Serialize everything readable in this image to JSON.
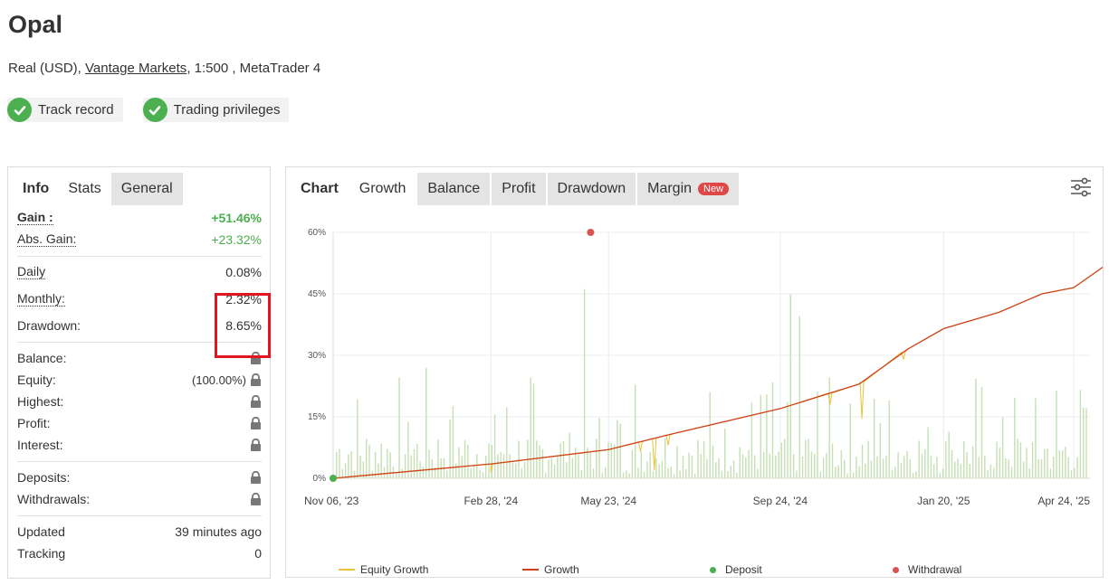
{
  "header": {
    "title": "Opal",
    "account_type": "Real (USD),",
    "broker": "Vantage Markets",
    "leverage_platform": ", 1:500 , MetaTrader 4"
  },
  "badges": [
    {
      "label": "Track record",
      "icon": "check-circle-icon"
    },
    {
      "label": "Trading privileges",
      "icon": "check-circle-icon"
    }
  ],
  "left_tabs": {
    "label": "Info",
    "items": [
      {
        "label": "Stats",
        "active": true
      },
      {
        "label": "General",
        "active": false
      }
    ]
  },
  "stats": {
    "gain": {
      "label": "Gain :",
      "value": "+51.46%"
    },
    "abs_gain": {
      "label": "Abs. Gain:",
      "value": "+23.32%"
    },
    "daily": {
      "label": "Daily",
      "value": "0.08%"
    },
    "monthly": {
      "label": "Monthly:",
      "value": "2.32%"
    },
    "drawdown": {
      "label": "Drawdown:",
      "value": "8.65%"
    },
    "balance": {
      "label": "Balance:"
    },
    "equity": {
      "label": "Equity:",
      "value": "(100.00%)"
    },
    "highest": {
      "label": "Highest:"
    },
    "profit": {
      "label": "Profit:"
    },
    "interest": {
      "label": "Interest:"
    },
    "deposits": {
      "label": "Deposits:"
    },
    "withdrawals": {
      "label": "Withdrawals:"
    },
    "updated": {
      "label": "Updated",
      "value": "39 minutes ago"
    },
    "tracking": {
      "label": "Tracking",
      "value": "0"
    }
  },
  "right_tabs": {
    "label": "Chart",
    "items": [
      {
        "label": "Growth",
        "active": true
      },
      {
        "label": "Balance",
        "active": false
      },
      {
        "label": "Profit",
        "active": false
      },
      {
        "label": "Drawdown",
        "active": false
      },
      {
        "label": "Margin",
        "active": false,
        "badge": "New"
      }
    ]
  },
  "colors": {
    "green": "#4caf50",
    "growth_line": "#d0421b",
    "equity_line": "#e8c33a",
    "bars": "#c5e0b4",
    "highlight": "#e3141e",
    "deposit": "#4caf50",
    "withdrawal": "#d9534f"
  },
  "chart_data": {
    "type": "line",
    "ylim": [
      0,
      60
    ],
    "y_ticks": [
      "0%",
      "15%",
      "30%",
      "45%",
      "60%"
    ],
    "x_tick_labels": [
      "Nov 06, '23",
      "Feb 28, '24",
      "May 23, '24",
      "Sep 24, '24",
      "Jan 20, '25",
      "Apr 24, '25"
    ],
    "series": [
      {
        "name": "Growth",
        "points": [
          [
            "Nov 06, '23",
            0
          ],
          [
            "Feb 28, '24",
            3.5
          ],
          [
            "May 23, '24",
            7
          ],
          [
            "Jul 10, '24",
            11
          ],
          [
            "Sep 24, '24",
            17
          ],
          [
            "Nov 20, '24",
            23
          ],
          [
            "Dec 25, '24",
            31.5
          ],
          [
            "Jan 20, '25",
            36.5
          ],
          [
            "Mar 01, '25",
            40.5
          ],
          [
            "Apr 01, '25",
            45
          ],
          [
            "Apr 24, '25",
            46.5
          ],
          [
            "May 15, '25",
            51.5
          ]
        ]
      },
      {
        "name": "Equity Growth",
        "dips": [
          [
            "Feb 28, '24",
            1.5
          ],
          [
            "Jun 15, '24",
            6.5
          ],
          [
            "Jun 25, '24",
            2
          ],
          [
            "Jul 05, '24",
            8
          ],
          [
            "Oct 30, '24",
            18
          ],
          [
            "Nov 22, '24",
            14.5
          ],
          [
            "Dec 22, '24",
            29
          ]
        ]
      },
      {
        "name": "Deposit",
        "points": [
          [
            "Nov 06, '23",
            0
          ]
        ]
      },
      {
        "name": "Withdrawal",
        "points": [
          [
            "May 10, '24",
            60
          ]
        ]
      }
    ],
    "legend": [
      "Equity Growth",
      "Growth",
      "Deposit",
      "Withdrawal"
    ],
    "legend_placement": "bottom"
  }
}
